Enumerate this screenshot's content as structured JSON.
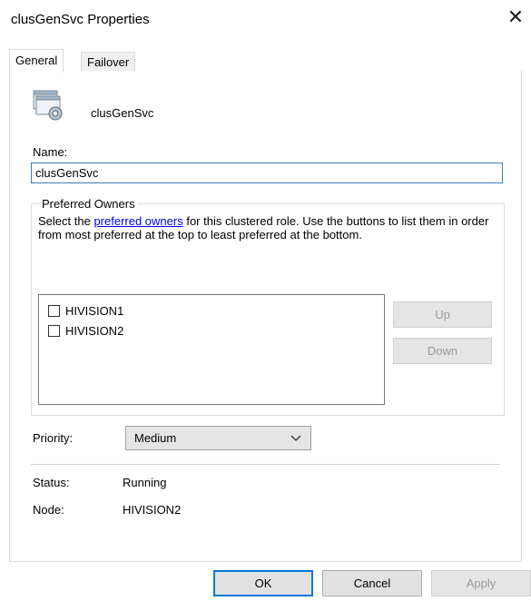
{
  "window": {
    "title": "clusGenSvc Properties",
    "close_glyph": "✕"
  },
  "tabs": [
    {
      "label": "General",
      "active": true
    },
    {
      "label": "Failover",
      "active": false
    }
  ],
  "general": {
    "role_icon": "clustered-service-icon",
    "role_name": "clusGenSvc",
    "name_label": "Name:",
    "name_value": "clusGenSvc",
    "preferred_owners": {
      "legend": "Preferred Owners",
      "desc_before": "Select the ",
      "desc_link": "preferred owners",
      "desc_after": " for this clustered role. Use the buttons to list them in order from most preferred at the top to least preferred at the bottom.",
      "owners": [
        {
          "name": "HIVISION1",
          "checked": false
        },
        {
          "name": "HIVISION2",
          "checked": false
        }
      ],
      "up_label": "Up",
      "down_label": "Down"
    },
    "priority_label": "Priority:",
    "priority_value": "Medium",
    "status_label": "Status:",
    "status_value": "Running",
    "node_label": "Node:",
    "node_value": "HIVISION2"
  },
  "footer": {
    "ok_label": "OK",
    "cancel_label": "Cancel",
    "apply_label": "Apply"
  },
  "colors": {
    "accent": "#0078d7",
    "link": "#0000ee",
    "disabled_text": "#9a9a9a"
  }
}
